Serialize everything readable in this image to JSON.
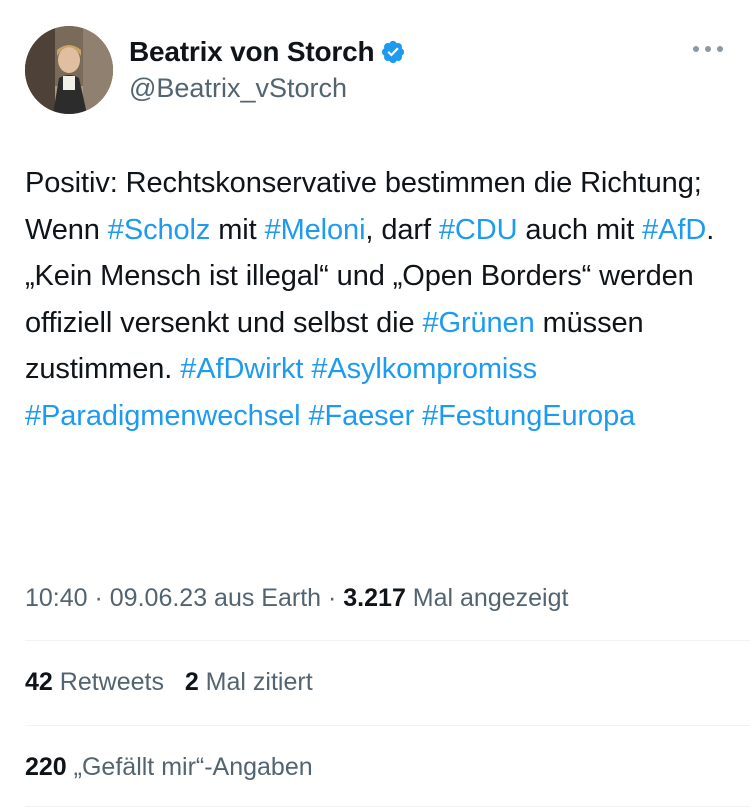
{
  "author": {
    "display_name": "Beatrix von Storch",
    "handle": "@Beatrix_vStorch",
    "verified_icon": "verified-badge-icon",
    "more_icon": "more-dots-icon"
  },
  "tweet": {
    "segments": [
      {
        "text": "Positiv: Rechtskonservative bestimmen die Richtung; Wenn ",
        "tag": false
      },
      {
        "text": "#Scholz",
        "tag": true
      },
      {
        "text": " mit ",
        "tag": false
      },
      {
        "text": "#Meloni",
        "tag": true
      },
      {
        "text": ", darf ",
        "tag": false
      },
      {
        "text": "#CDU",
        "tag": true
      },
      {
        "text": " auch mit ",
        "tag": false
      },
      {
        "text": "#AfD",
        "tag": true
      },
      {
        "text": ". „Kein Mensch ist illegal“ und „Open Borders“ werden offiziell versenkt und selbst die ",
        "tag": false
      },
      {
        "text": "#Grünen",
        "tag": true
      },
      {
        "text": " müssen zustimmen. ",
        "tag": false
      },
      {
        "text": "#AfDwirkt",
        "tag": true
      },
      {
        "text": " ",
        "tag": false
      },
      {
        "text": "#Asylkompromiss",
        "tag": true
      },
      {
        "text": " ",
        "tag": false
      },
      {
        "text": "#Paradigmenwechsel",
        "tag": true
      },
      {
        "text": " ",
        "tag": false
      },
      {
        "text": "#Faeser",
        "tag": true
      },
      {
        "text": " ",
        "tag": false
      },
      {
        "text": "#FestungEuropa",
        "tag": true
      }
    ]
  },
  "meta": {
    "time": "10:40",
    "sep1": " · ",
    "date": "09.06.23",
    "source": " aus Earth",
    "sep2": " · ",
    "views_count": "3.217",
    "views_label": " Mal angezeigt"
  },
  "stats": {
    "retweets_count": "42",
    "retweets_label": " Retweets",
    "quotes_count": "2",
    "quotes_label": " Mal zitiert",
    "likes_count": "220",
    "likes_label": " „Gefällt mir“-Angaben"
  },
  "colors": {
    "link": "#1d9bf0",
    "secondary": "#536471",
    "primary": "#0f1419",
    "divider": "#eff3f4"
  }
}
